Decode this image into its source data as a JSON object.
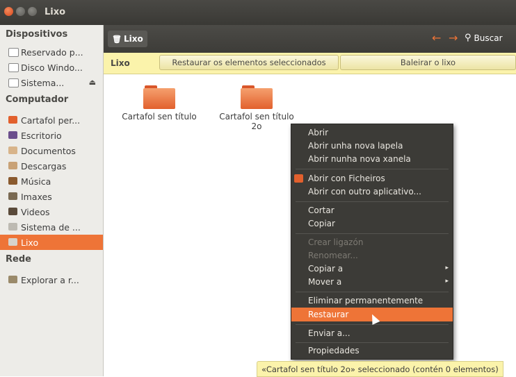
{
  "window": {
    "title": "Lixo"
  },
  "sidebar": {
    "sections": [
      {
        "heading": "Dispositivos"
      },
      {
        "heading": "Computador"
      },
      {
        "heading": "Rede"
      }
    ],
    "devices": [
      "Reservado p...",
      "Disco Windo...",
      "Sistema..."
    ],
    "computer": [
      "Cartafol per...",
      "Escritorio",
      "Documentos",
      "Descargas",
      "Música",
      "Imaxes",
      "Videos",
      "Sistema de ...",
      "Lixo"
    ],
    "network": [
      "Explorar a r..."
    ]
  },
  "toolbar": {
    "location": "Lixo",
    "search": "Buscar"
  },
  "infobar": {
    "label": "Lixo",
    "restore_button": "Restaurar os elementos seleccionados",
    "empty_button": "Baleirar o lixo"
  },
  "folders": [
    {
      "name": "Cartafol sen título"
    },
    {
      "name": "Cartafol sen título 2o"
    }
  ],
  "context_menu": {
    "items": [
      "Abrir",
      "Abrir unha nova lapela",
      "Abrir nunha nova xanela",
      "Abrir con Ficheiros",
      "Abrir con outro aplicativo...",
      "Cortar",
      "Copiar",
      "Crear ligazón",
      "Renomear...",
      "Copiar a",
      "Mover a",
      "Eliminar permanentemente",
      "Restaurar",
      "Enviar a...",
      "Propiedades"
    ]
  },
  "status": "«Cartafol sen título 2o» seleccionado (contén 0 elementos)",
  "colors": {
    "accent": "#ee7437",
    "titlebar": "#3c3b37",
    "infobar": "#fbf3ab",
    "sidebar": "#edece8"
  }
}
